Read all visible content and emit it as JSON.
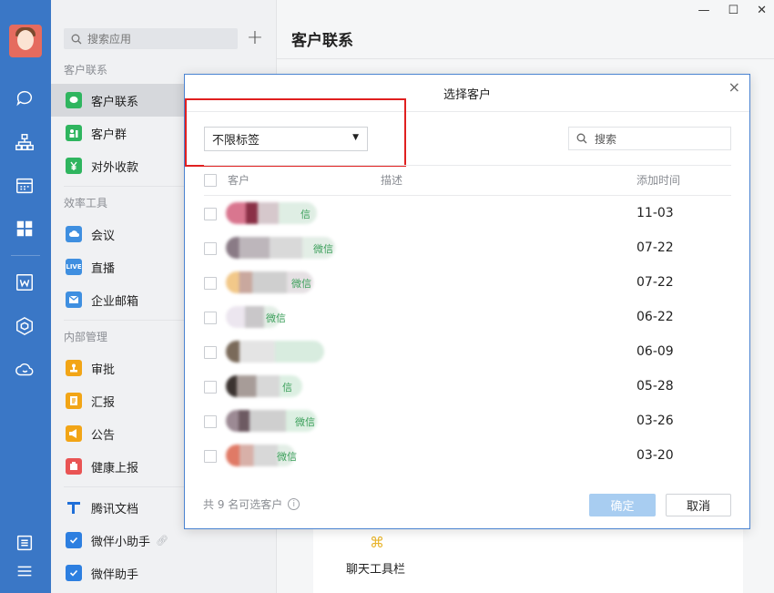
{
  "rail": {
    "icons": [
      "chat-icon",
      "org-icon",
      "calendar-icon",
      "apps-icon",
      "docs-icon",
      "cube-icon",
      "cloud-icon",
      "settings-icon",
      "menu-icon"
    ]
  },
  "panel": {
    "search_placeholder": "搜索应用",
    "add_symbol": "+",
    "sections": [
      {
        "title": "客户联系",
        "items": [
          {
            "label": "客户联系",
            "icon": "chat-bubble-icon",
            "color": "#2fb55f",
            "active": true
          },
          {
            "label": "客户群",
            "icon": "group-icon",
            "color": "#2fb55f"
          },
          {
            "label": "对外收款",
            "icon": "yuan-icon",
            "color": "#2fb55f"
          }
        ]
      },
      {
        "title": "效率工具",
        "items": [
          {
            "label": "会议",
            "icon": "cloud-meeting-icon",
            "color": "#3f8fe0"
          },
          {
            "label": "直播",
            "icon": "live-icon",
            "color": "#3f8fe0",
            "badge": "LIVE"
          },
          {
            "label": "企业邮箱",
            "icon": "mail-icon",
            "color": "#3f8fe0"
          }
        ]
      },
      {
        "title": "内部管理",
        "items": [
          {
            "label": "审批",
            "icon": "approval-icon",
            "color": "#f2a516"
          },
          {
            "label": "汇报",
            "icon": "report-icon",
            "color": "#f2a516"
          },
          {
            "label": "公告",
            "icon": "announcement-icon",
            "color": "#f2a516"
          },
          {
            "label": "健康上报",
            "icon": "health-icon",
            "color": "#e95454"
          }
        ]
      }
    ],
    "extra_items": [
      {
        "label": "腾讯文档",
        "icon": "tencent-docs-icon",
        "color": "#1f6fd8"
      },
      {
        "label": "微伴小助手",
        "icon": "check-badge-icon",
        "color": "#2d7fe0"
      },
      {
        "label": "微伴助手",
        "icon": "check-badge-icon",
        "color": "#2d7fe0"
      }
    ]
  },
  "main": {
    "title": "客户联系",
    "toolbar_label": "聊天工具栏"
  },
  "dialog": {
    "title": "选择客户",
    "close": "×",
    "filter_value": "不限标签",
    "search_placeholder": "搜索",
    "columns": {
      "customer": "客户",
      "description": "描述",
      "added": "添加时间"
    },
    "rows": [
      {
        "tag": "信",
        "date": "11-03"
      },
      {
        "tag": "微信",
        "date": "07-22"
      },
      {
        "tag": "微信",
        "date": "07-22"
      },
      {
        "tag": "微信",
        "date": "06-22"
      },
      {
        "tag": "",
        "date": "06-09"
      },
      {
        "tag": "信",
        "date": "05-28"
      },
      {
        "tag": "微信",
        "date": "03-26"
      },
      {
        "tag": "微信",
        "date": "03-20"
      }
    ],
    "footer_text": "共 9 名可选客户",
    "ok_label": "确定",
    "cancel_label": "取消"
  }
}
